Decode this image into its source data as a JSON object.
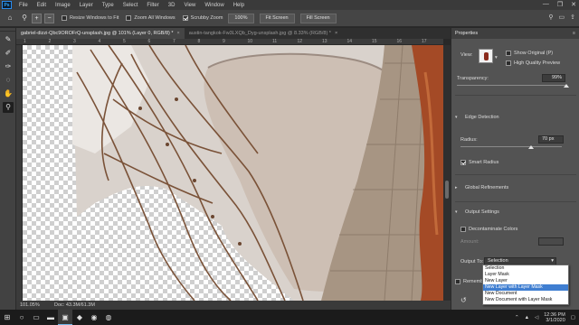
{
  "app": {
    "logo": "Ps"
  },
  "menu": [
    "File",
    "Edit",
    "Image",
    "Layer",
    "Type",
    "Select",
    "Filter",
    "3D",
    "View",
    "Window",
    "Help"
  ],
  "window_controls": [
    "—",
    "❐",
    "✕"
  ],
  "options_bar": {
    "resize_windows": "Resize Windows to Fit",
    "zoom_all_windows": "Zoom All Windows",
    "scrubby_zoom": "Scrubby Zoom",
    "zoom_100": "100%",
    "fit_screen": "Fit Screen",
    "fill_screen": "Fill Screen"
  },
  "tabs": [
    {
      "title": "gabriel-dizzi-Qbc9OROFrQ-unsplash.jpg @ 101% (Layer 0, RGB/8) *",
      "active": true
    },
    {
      "title": "austin-tangkok-Fw3LXQb_Dyg-unsplash.jpg @ 8.33% (RGB/8) *",
      "active": false
    }
  ],
  "ruler": [
    "1",
    "2",
    "3",
    "4",
    "5",
    "6",
    "7",
    "8",
    "9",
    "10",
    "11",
    "12",
    "13",
    "14",
    "15",
    "16",
    "17"
  ],
  "status": {
    "zoom": "101.05%",
    "doc": "Doc: 43.3M/61.3M"
  },
  "properties": {
    "title": "Properties",
    "view_label": "View:",
    "show_original": "Show Original (P)",
    "high_quality_preview": "High Quality Preview",
    "transparency_label": "Transparency:",
    "transparency_value": "99%",
    "transparency_fraction": 0.99,
    "edge_detection": "Edge Detection",
    "radius_label": "Radius:",
    "radius_value": "70 px",
    "radius_fraction": 0.7,
    "smart_radius": "Smart Radius",
    "global_refinements": "Global Refinements",
    "output_settings": "Output Settings",
    "decontaminate_colors": "Decontaminate Colors",
    "amount_label": "Amount:",
    "output_to_label": "Output To:",
    "output_to_value": "Selection",
    "remember_label": "Remember"
  },
  "dropdown": {
    "items": [
      "Selection",
      "Layer Mask",
      "New Layer",
      "New Layer with Layer Mask",
      "New Document",
      "New Document with Layer Mask"
    ],
    "selected_index": 3
  },
  "taskbar": {
    "time": "12:36 PM",
    "date": "3/1/2020"
  },
  "colors": {
    "dropdown_highlight": "#3f7ed1",
    "panel_bg": "#535353",
    "canvas_wall": "#cfc7c0"
  }
}
